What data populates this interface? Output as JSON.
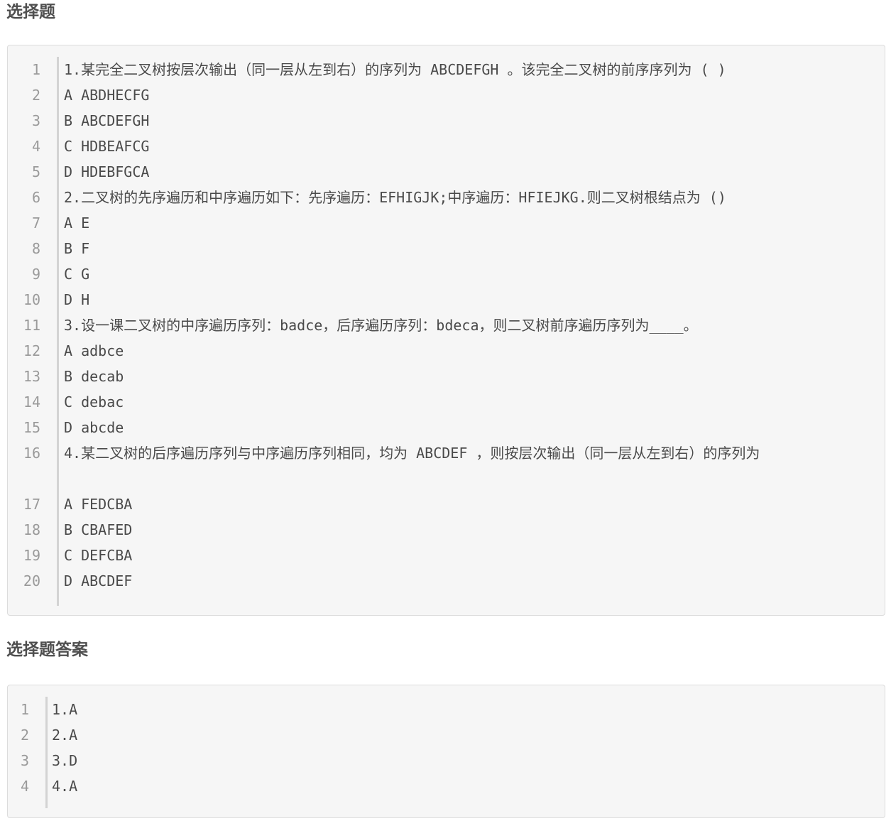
{
  "section1": {
    "title": "选择题",
    "lines": [
      "1.某完全二叉树按层次输出（同一层从左到右）的序列为 ABCDEFGH 。该完全二叉树的前序序列为 ( )",
      "A ABDHECFG",
      "B ABCDEFGH",
      "C HDBEAFCG",
      "D HDEBFGCA",
      "2.二叉树的先序遍历和中序遍历如下：先序遍历：EFHIGJK;中序遍历：HFIEJKG.则二叉树根结点为 ()",
      "A E",
      "B F",
      "C G",
      "D H",
      "3.设一课二叉树的中序遍历序列：badce，后序遍历序列：bdeca，则二叉树前序遍历序列为____。",
      "A adbce",
      "B decab",
      "C debac",
      "D abcde",
      "4.某二叉树的后序遍历序列与中序遍历序列相同，均为 ABCDEF ，则按层次输出（同一层从左到右）的序列为",
      "A FEDCBA",
      "B CBAFED",
      "C DEFCBA",
      "D ABCDEF"
    ],
    "line_numbers": [
      "1",
      "2",
      "3",
      "4",
      "5",
      "6",
      "7",
      "8",
      "9",
      "10",
      "11",
      "12",
      "13",
      "14",
      "15",
      "16",
      "17",
      "18",
      "19",
      "20"
    ]
  },
  "section2": {
    "title": "选择题答案",
    "lines": [
      "1.A",
      "2.A",
      "3.D",
      "4.A"
    ],
    "line_numbers": [
      "1",
      "2",
      "3",
      "4"
    ]
  }
}
